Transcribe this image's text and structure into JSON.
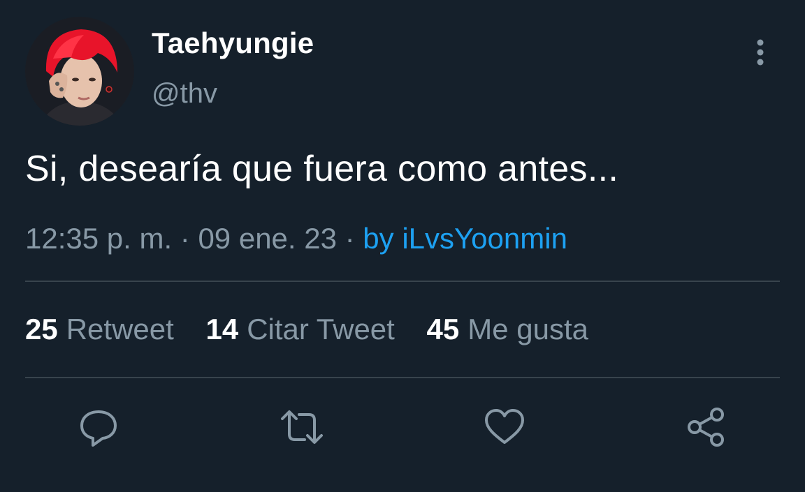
{
  "author": {
    "display_name": "Taehyungie",
    "handle": "@thv"
  },
  "tweet": {
    "text": "Si, desearía que fuera como antes...",
    "time": "12:35 p. m.",
    "sep1": " · ",
    "date": "09 ene. 23",
    "sep2": " · ",
    "via": "by iLvsYoonmin"
  },
  "stats": {
    "retweets": {
      "count": "25",
      "label": "Retweet"
    },
    "quotes": {
      "count": "14",
      "label": "Citar Tweet"
    },
    "likes": {
      "count": "45",
      "label": "Me gusta"
    }
  },
  "actions": [
    "reply-icon",
    "retweet-icon",
    "like-icon",
    "share-icon"
  ],
  "colors": {
    "background": "#15202b",
    "primary_text": "#ffffff",
    "secondary_text": "#8899a6",
    "link": "#1da1f2",
    "divider": "#38444d"
  }
}
